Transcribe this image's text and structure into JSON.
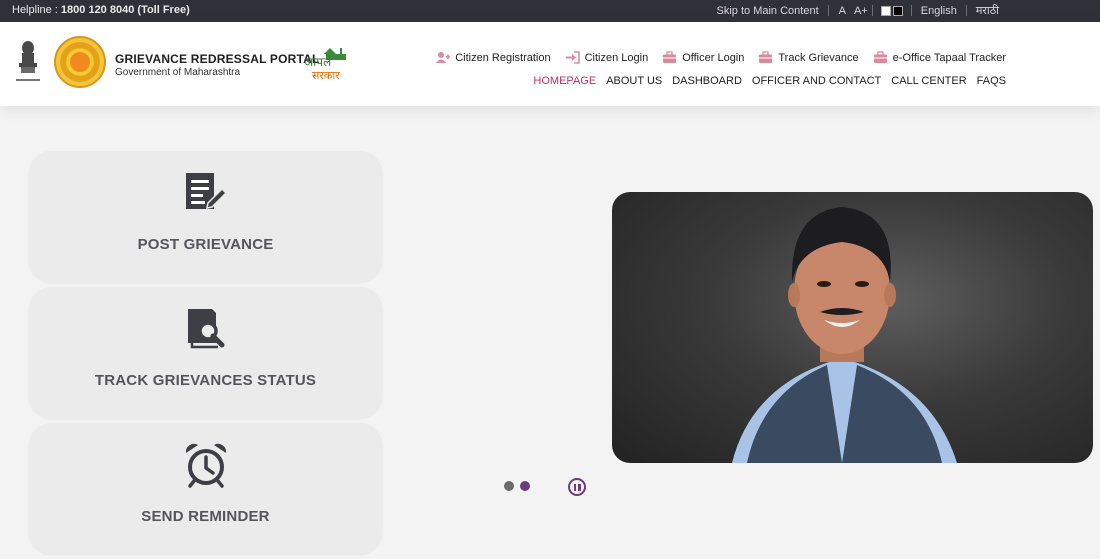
{
  "topbar": {
    "helpline_label": "Helpline :",
    "helpline_number": "1800 120 8040 (Toll Free)",
    "skip_link": "Skip to Main Content",
    "font_normal": "A",
    "font_plus": "A+",
    "lang_english": "English",
    "lang_marathi": "मराठी"
  },
  "header": {
    "emblem_caption": "सत्यमेव जयते",
    "title": "GRIEVANCE REDRESSAL PORTAL",
    "subtitle": "Government of Maharashtra",
    "aple_logo": "आपले सरकार",
    "quick_links": [
      {
        "label": "Citizen Registration",
        "icon": "user-plus-icon"
      },
      {
        "label": "Citizen Login",
        "icon": "login-icon"
      },
      {
        "label": "Officer Login",
        "icon": "briefcase-icon"
      },
      {
        "label": "Track Grievance",
        "icon": "briefcase-icon"
      },
      {
        "label": "e-Office Tapaal Tracker",
        "icon": "briefcase-icon"
      }
    ],
    "nav": [
      {
        "label": "HOMEPAGE",
        "active": true
      },
      {
        "label": "ABOUT US"
      },
      {
        "label": "DASHBOARD"
      },
      {
        "label": "OFFICER AND CONTACT"
      },
      {
        "label": "CALL CENTER"
      },
      {
        "label": "FAQS"
      }
    ]
  },
  "cards": [
    {
      "label": "POST GRIEVANCE",
      "icon": "document-edit-icon"
    },
    {
      "label": "TRACK GRIEVANCES STATUS",
      "icon": "document-search-icon"
    },
    {
      "label": "SEND REMINDER",
      "icon": "alarm-clock-icon"
    }
  ],
  "slider": {
    "dots": 2,
    "active_dot": 2,
    "state": "playing"
  },
  "colors": {
    "accent": "#c0306a",
    "topbar": "#2f3138",
    "card": "#ebebeb",
    "slider_control": "#6b3d7d"
  }
}
